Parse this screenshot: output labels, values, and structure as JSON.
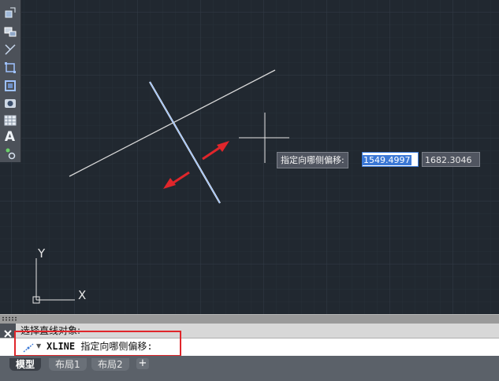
{
  "toolbar": {
    "items": [
      "edit-block-icon",
      "insert-block-icon",
      "trim-icon",
      "move-icon",
      "select-window-icon",
      "camera-icon",
      "table-icon",
      "text-icon",
      "point-style-icon"
    ],
    "text_tool_label": "A"
  },
  "tooltip": {
    "prompt": "指定向哪侧偏移:",
    "x_value": "1549.4997",
    "y_value": "1682.3046"
  },
  "ucs": {
    "y_label": "Y",
    "x_label": "X"
  },
  "command": {
    "history": "选择直线对象:",
    "name": "XLINE",
    "prompt": "指定向哪侧偏移:"
  },
  "tabs": [
    {
      "label": "模型",
      "active": true
    },
    {
      "label": "布局1",
      "active": false
    },
    {
      "label": "布局2",
      "active": false
    }
  ],
  "tab_add_label": "+",
  "colors": {
    "canvas": "#212830",
    "selected_line": "#6fa6ff",
    "arrow": "#e0262b",
    "highlight": "#e0262b"
  }
}
